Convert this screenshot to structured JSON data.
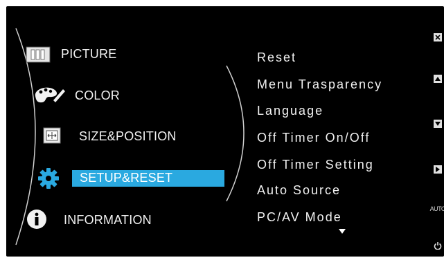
{
  "colors": {
    "background": "#000000",
    "text": "#f2f2f2",
    "highlight": "#2aa9e0",
    "icon_blue": "#2aa9e0"
  },
  "categories": [
    {
      "label": "PICTURE",
      "icon": "picture-icon",
      "selected": false
    },
    {
      "label": "COLOR",
      "icon": "palette-icon",
      "selected": false
    },
    {
      "label": "SIZE&POSITION",
      "icon": "size-position-icon",
      "selected": false
    },
    {
      "label": "SETUP&RESET",
      "icon": "gear-icon",
      "selected": true
    },
    {
      "label": "INFORMATION",
      "icon": "info-icon",
      "selected": false
    }
  ],
  "submenu": [
    "Reset",
    "Menu Trasparency",
    "Language",
    "Off Timer On/Off",
    "Off Timer Setting",
    "Auto Source",
    "PC/AV Mode"
  ],
  "side_buttons": [
    {
      "icon": "close-icon"
    },
    {
      "icon": "up-icon"
    },
    {
      "icon": "down-icon"
    },
    {
      "icon": "enter-icon"
    },
    {
      "icon": "auto-icon",
      "text": "AUTO"
    },
    {
      "icon": "power-icon"
    }
  ],
  "more_indicator": "scroll-down-icon"
}
